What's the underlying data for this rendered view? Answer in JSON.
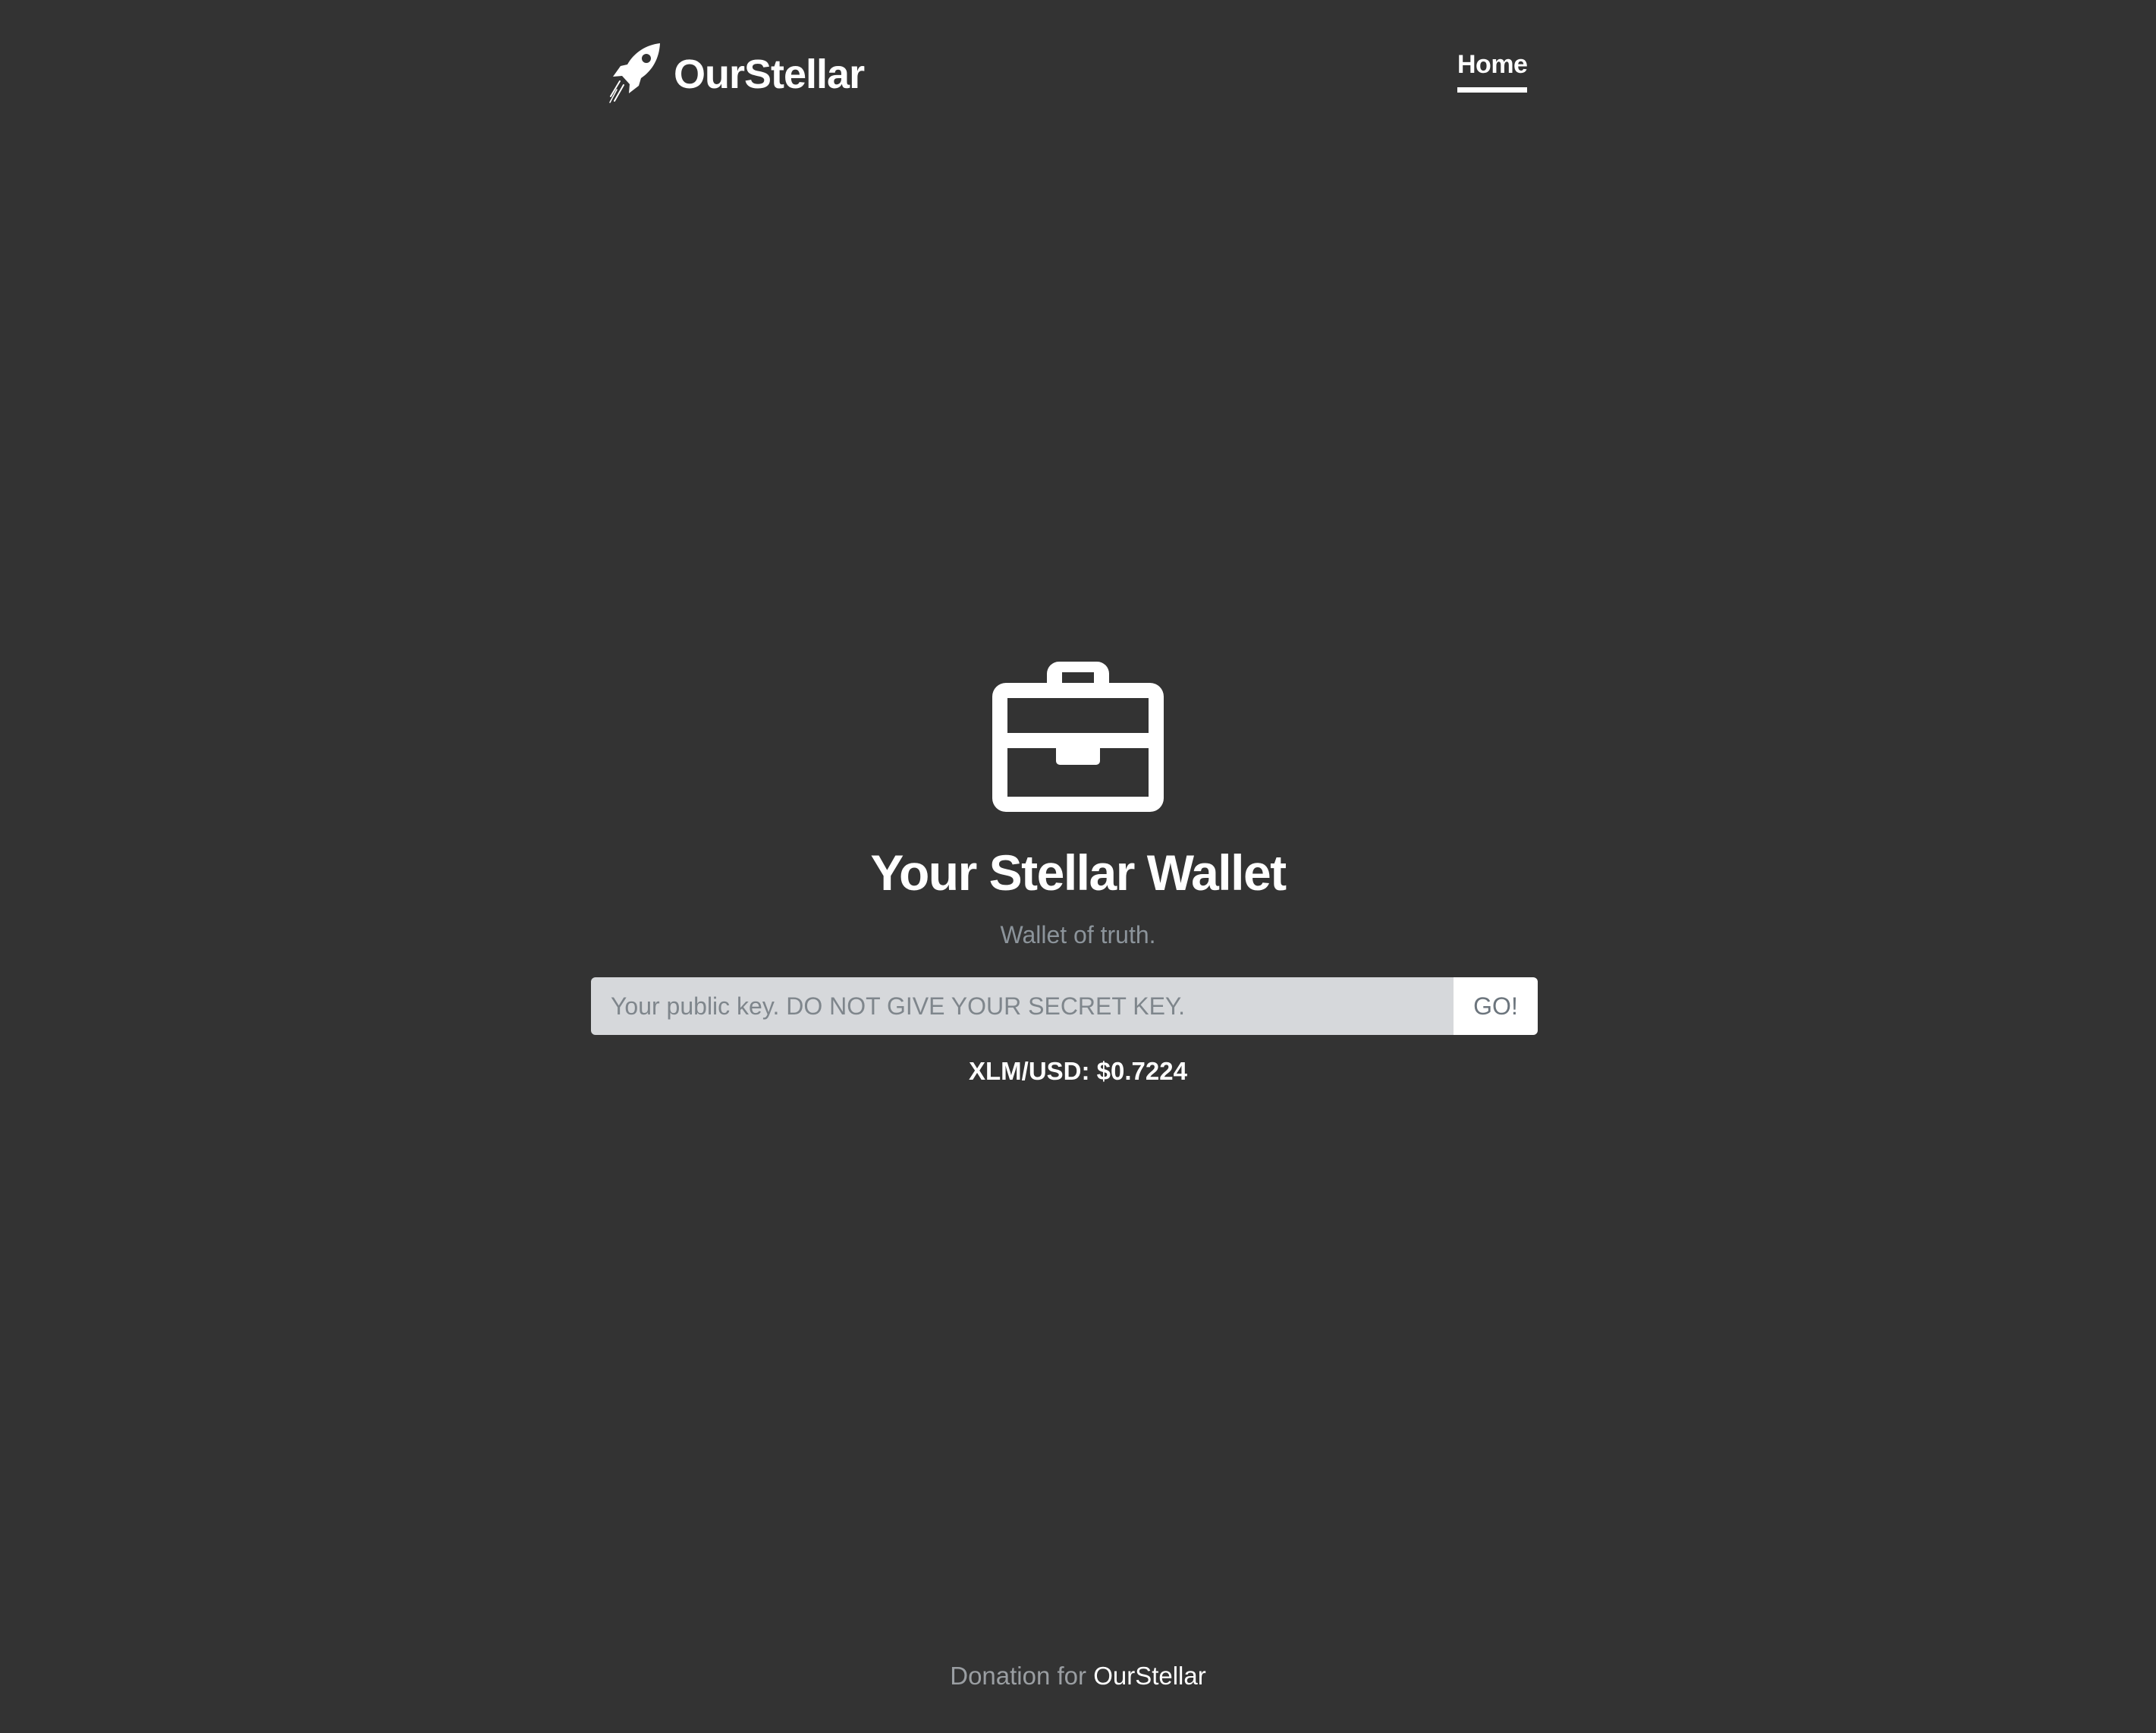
{
  "header": {
    "brand_name": "OurStellar",
    "logo_icon": "rocket-icon",
    "nav": {
      "home_label": "Home"
    }
  },
  "hero": {
    "icon": "briefcase-icon",
    "title": "Your Stellar Wallet",
    "subtitle": "Wallet of truth."
  },
  "search": {
    "placeholder": "Your public key. DO NOT GIVE YOUR SECRET KEY.",
    "value": "",
    "button_label": "GO!"
  },
  "price": {
    "text": "XLM/USD: $0.7224"
  },
  "footer": {
    "prefix": "Donation for",
    "link_label": "OurStellar"
  },
  "colors": {
    "background": "#333333",
    "text": "#ffffff",
    "muted": "#8c949b",
    "input_background": "#d6d8db"
  }
}
